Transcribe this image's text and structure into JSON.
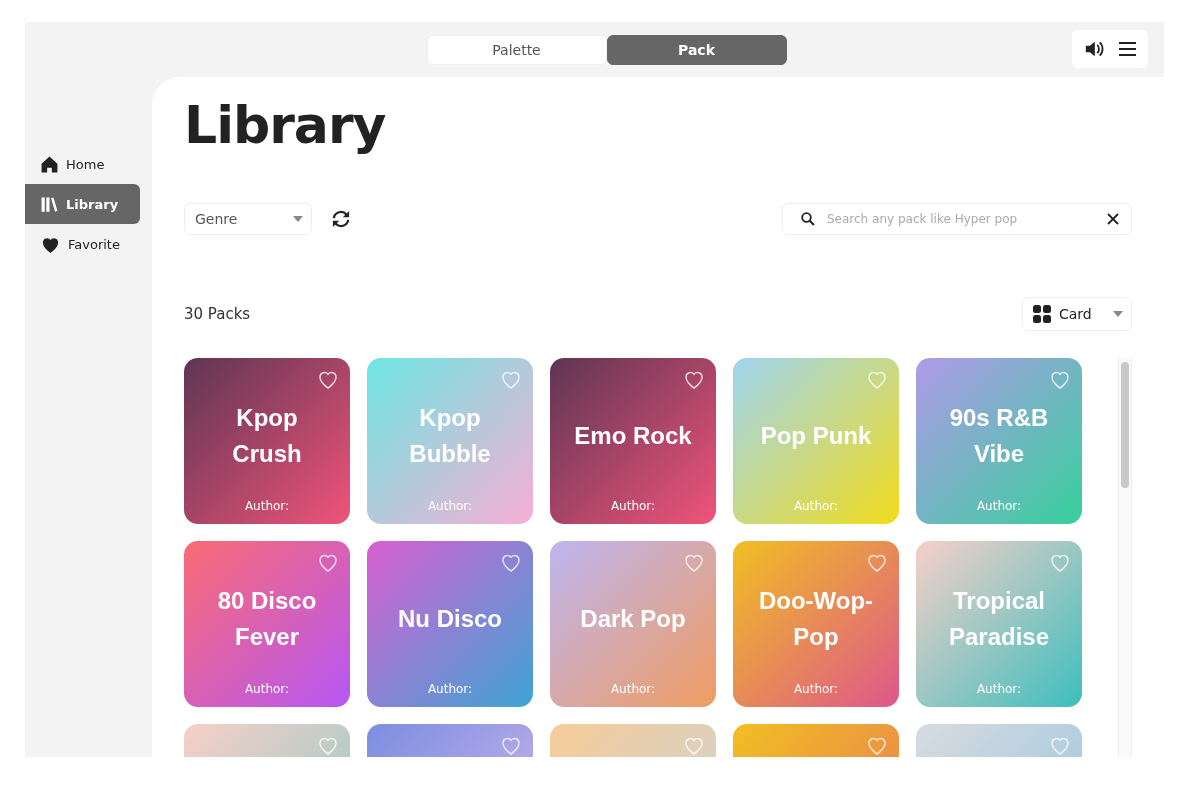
{
  "mode_tabs": [
    {
      "label": "Palette",
      "selected": false
    },
    {
      "label": "Pack",
      "selected": true
    }
  ],
  "sidebar": {
    "items": [
      {
        "label": "Home",
        "selected": false
      },
      {
        "label": "Library",
        "selected": true
      },
      {
        "label": "Favorite",
        "selected": false
      }
    ]
  },
  "page_title": "Library",
  "genre_select": {
    "value": "Genre"
  },
  "search": {
    "placeholder": "Search any pack like Hyper pop"
  },
  "pack_count": "30 Packs",
  "view_select": {
    "value": "Card"
  },
  "cards": [
    {
      "title": "Kpop Crush",
      "author": "Author:",
      "favorite": false
    },
    {
      "title": "Kpop Bubble",
      "author": "Author:",
      "favorite": false
    },
    {
      "title": "Emo Rock",
      "author": "Author:",
      "favorite": false
    },
    {
      "title": "Pop Punk",
      "author": "Author:",
      "favorite": false
    },
    {
      "title": "90s R&B Vibe",
      "author": "Author:",
      "favorite": false
    },
    {
      "title": "80 Disco Fever",
      "author": "Author:",
      "favorite": false
    },
    {
      "title": "Nu Disco",
      "author": "Author:",
      "favorite": false
    },
    {
      "title": "Dark Pop",
      "author": "Author:",
      "favorite": false
    },
    {
      "title": "Doo-Wop-Pop",
      "author": "Author:",
      "favorite": false
    },
    {
      "title": "Tropical Paradise",
      "author": "Author:",
      "favorite": false
    },
    {
      "favorite": false
    },
    {
      "favorite": false
    },
    {
      "favorite": false
    },
    {
      "favorite": false
    },
    {
      "favorite": false
    }
  ]
}
